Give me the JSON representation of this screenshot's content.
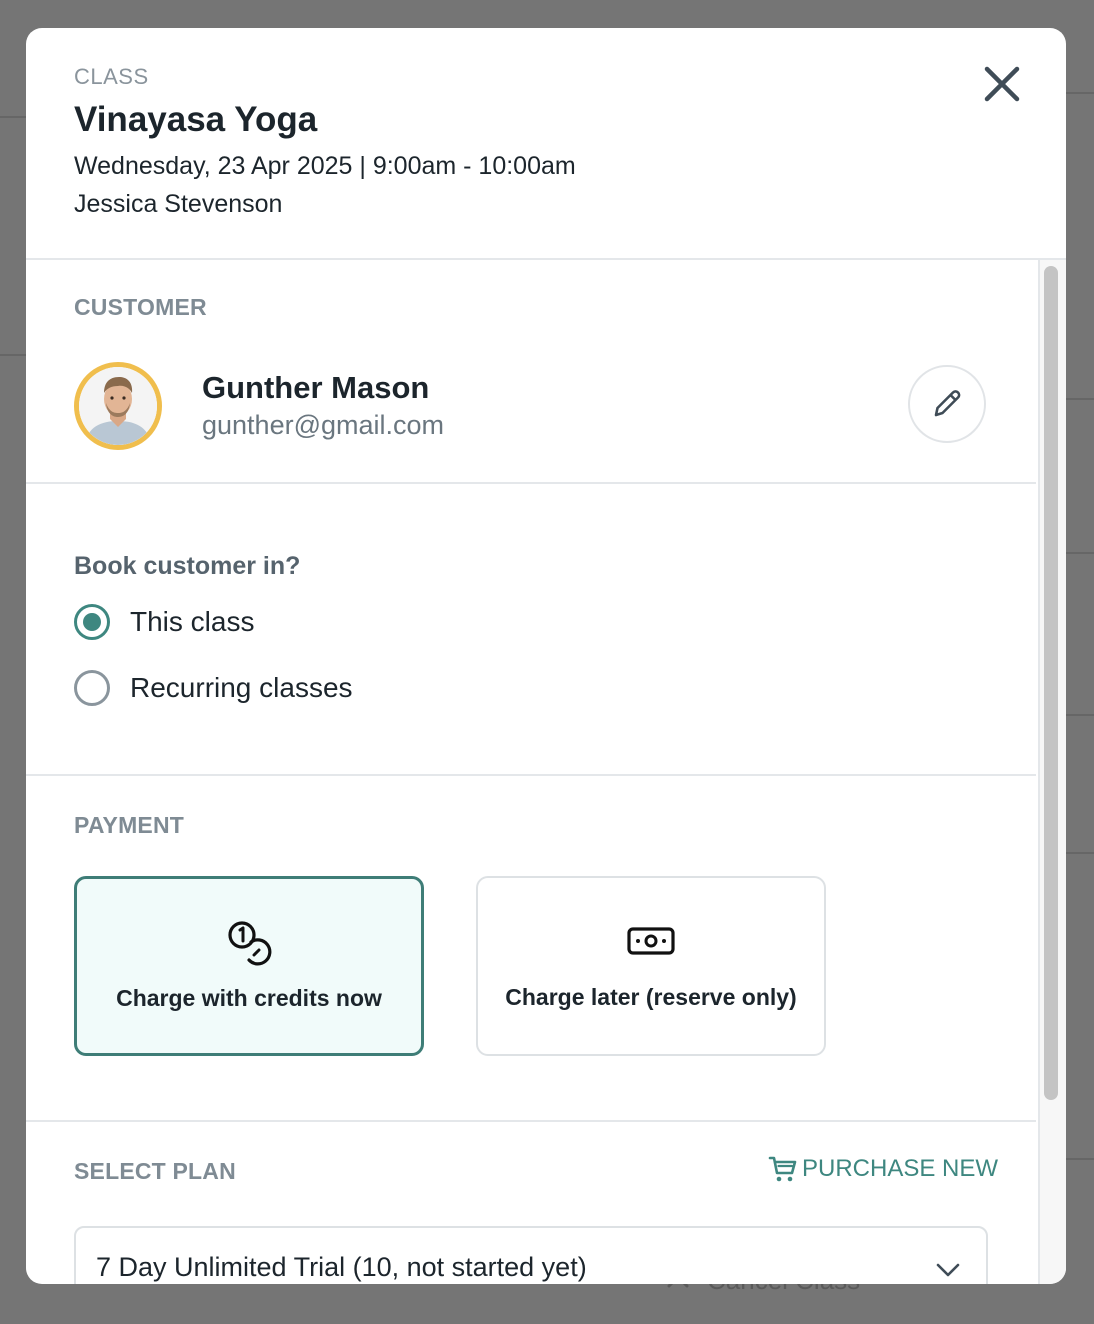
{
  "background": {
    "partial_text": "Cancel Class"
  },
  "header": {
    "eyebrow": "CLASS",
    "title": "Vinayasa Yoga",
    "datetime": "Wednesday, 23 Apr 2025 | 9:00am - 10:00am",
    "instructor": "Jessica Stevenson",
    "close_icon": "close-icon"
  },
  "customer": {
    "section_label": "CUSTOMER",
    "name": "Gunther Mason",
    "email": "gunther@gmail.com",
    "avatar_ring_color": "#f0be4d",
    "edit_icon": "pencil-icon"
  },
  "booking": {
    "question": "Book customer in?",
    "options": [
      {
        "label": "This class",
        "selected": true
      },
      {
        "label": "Recurring classes",
        "selected": false
      }
    ]
  },
  "payment": {
    "section_label": "PAYMENT",
    "options": [
      {
        "label": "Charge with credits now",
        "icon": "coins-icon",
        "selected": true
      },
      {
        "label": "Charge later (reserve only)",
        "icon": "cash-icon",
        "selected": false
      }
    ]
  },
  "plan": {
    "section_label": "SELECT PLAN",
    "purchase_new_label": "PURCHASE NEW",
    "purchase_icon": "cart-icon",
    "selected_value": "7 Day Unlimited Trial (10, not started yet)"
  },
  "colors": {
    "accent": "#3e8780",
    "selected_card_bg": "#f1fbfa",
    "overlay": "#757575"
  }
}
